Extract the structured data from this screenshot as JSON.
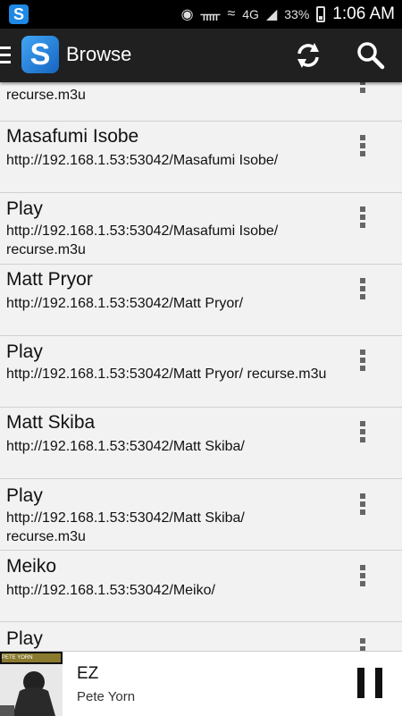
{
  "status_bar": {
    "network": "4G",
    "battery": "33%",
    "time": "1:06 AM"
  },
  "action_bar": {
    "title": "Browse"
  },
  "list": {
    "partial_top_title": "recurse.m3u",
    "items": [
      {
        "title": "Masafumi Isobe",
        "url": "http://192.168.1.53:53042/Masafumi Isobe/"
      },
      {
        "title": "Play",
        "url": "http://192.168.1.53:53042/Masafumi Isobe/ recurse.m3u"
      },
      {
        "title": "Matt Pryor",
        "url": "http://192.168.1.53:53042/Matt Pryor/"
      },
      {
        "title": "Play",
        "url": "http://192.168.1.53:53042/Matt Pryor/ recurse.m3u"
      },
      {
        "title": "Matt Skiba",
        "url": "http://192.168.1.53:53042/Matt Skiba/"
      },
      {
        "title": "Play",
        "url": "http://192.168.1.53:53042/Matt Skiba/ recurse.m3u"
      },
      {
        "title": "Meiko",
        "url": "http://192.168.1.53:53042/Meiko/"
      },
      {
        "title": "Play",
        "url": ""
      }
    ]
  },
  "now_playing": {
    "title": "EZ",
    "artist": "Pete Yorn",
    "art_text": "PETE YORN"
  },
  "icons": {
    "app": "app-icon",
    "refresh": "refresh-icon",
    "search": "search-icon",
    "overflow": "overflow-menu-icon",
    "pause": "pause-icon"
  }
}
